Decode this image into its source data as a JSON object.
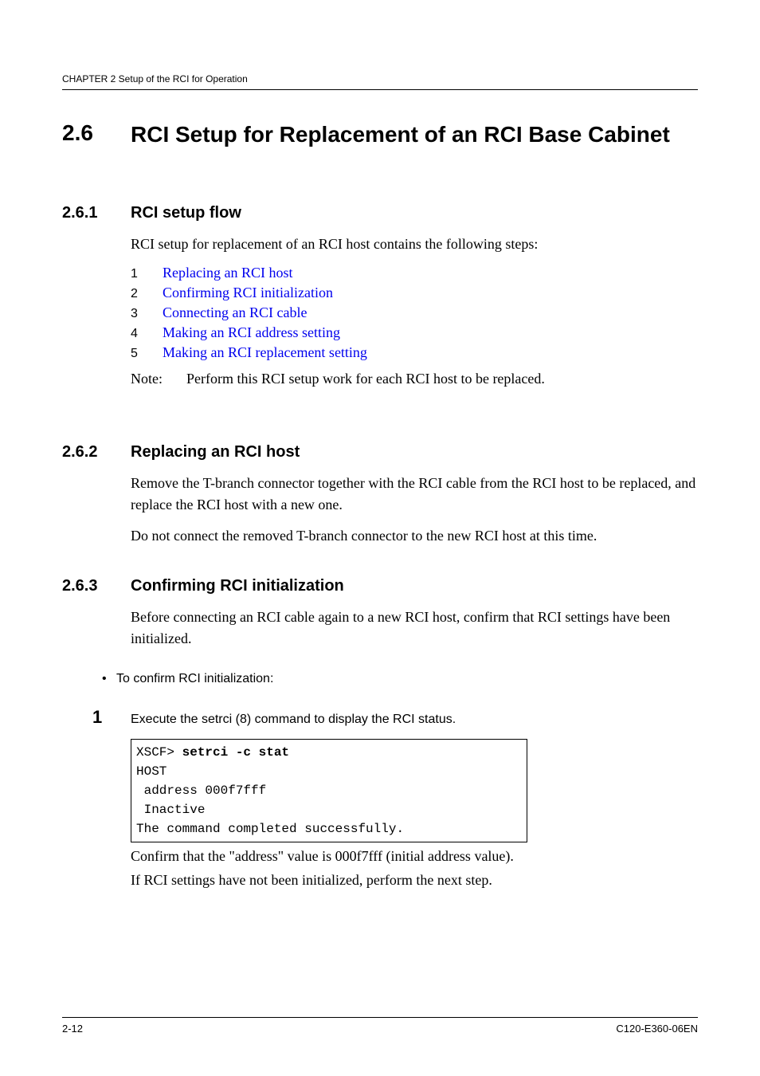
{
  "header": {
    "chapter": "CHAPTER 2  Setup of the RCI for Operation"
  },
  "section": {
    "number": "2.6",
    "title": "RCI Setup for Replacement of an RCI Base Cabinet"
  },
  "sub261": {
    "number": "2.6.1",
    "title": "RCI setup flow",
    "intro": "RCI setup for replacement of an RCI host contains the following steps:",
    "steps": [
      {
        "n": "1",
        "label": "Replacing an RCI host"
      },
      {
        "n": "2",
        "label": "Confirming RCI initialization"
      },
      {
        "n": "3",
        "label": "Connecting an RCI cable"
      },
      {
        "n": "4",
        "label": "Making an RCI address setting"
      },
      {
        "n": "5",
        "label": "Making an RCI replacement setting"
      }
    ],
    "note_label": "Note:",
    "note_text": "Perform this RCI setup work for each RCI host to be replaced."
  },
  "sub262": {
    "number": "2.6.2",
    "title": "Replacing an RCI host",
    "p1": "Remove the T-branch connector together with the RCI cable from the RCI host to be replaced, and replace the RCI host with a new one.",
    "p2": "Do not connect the removed T-branch connector to the new RCI host at this time."
  },
  "sub263": {
    "number": "2.6.3",
    "title": "Confirming RCI initialization",
    "p1": "Before connecting an RCI cable again to a new RCI host, confirm that RCI settings have been initialized.",
    "bullet": "To confirm RCI initialization:",
    "step1_num": "1",
    "step1_text": "Execute the setrci (8) command to display the RCI status.",
    "code_prompt": "XSCF> ",
    "code_cmd": "setrci -c stat",
    "code_body": "HOST\n address 000f7fff\n Inactive\nThe command completed successfully.",
    "after1": "Confirm that the \"address\" value is 000f7fff (initial address value).",
    "after2": "If RCI settings have not been initialized, perform the next step."
  },
  "footer": {
    "page": "2-12",
    "docid": "C120-E360-06EN"
  }
}
